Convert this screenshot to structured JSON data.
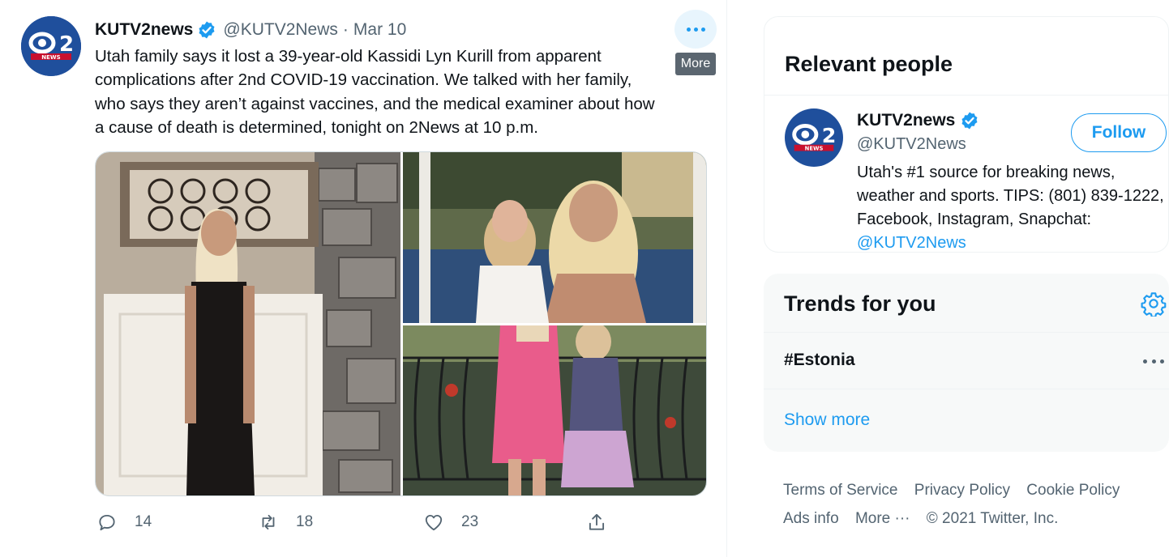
{
  "tweet": {
    "author": {
      "display_name": "KUTV2news",
      "handle": "@KUTV2News",
      "verified": true,
      "avatar_text": "2",
      "avatar_subtext": "NEWS"
    },
    "separator": "·",
    "date": "Mar 10",
    "more_tooltip": "More",
    "text": "Utah family says it lost a 39-year-old Kassidi Lyn Kurill  from apparent\ncomplications after 2nd COVID-19 vaccination. We talked with her family,\nwho says they aren’t against vaccines, and the medical examiner about how\na cause of death is determined, tonight on 2News at 10 p.m.",
    "media": [
      {
        "kind": "photo",
        "subject": "woman in black dress by stone wall"
      },
      {
        "kind": "photo",
        "subject": "woman and girl at restaurant patio"
      },
      {
        "kind": "photo",
        "subject": "woman in pink dress with girl by iron fence"
      }
    ],
    "actions": {
      "replies": "14",
      "retweets": "18",
      "likes": "23"
    }
  },
  "sidebar": {
    "relevant_people": {
      "title": "Relevant people",
      "person": {
        "display_name": "KUTV2news",
        "handle": "@KUTV2News",
        "bio": "Utah's #1 source for breaking news, weather and sports. TIPS: (801) 839-1222, Facebook, Instagram, Snapchat: ",
        "bio_link": "@KUTV2News",
        "follow_label": "Follow"
      }
    },
    "trends": {
      "title": "Trends for you",
      "items": [
        {
          "name": "#Estonia"
        }
      ],
      "show_more": "Show more"
    },
    "footer": {
      "links": [
        "Terms of Service",
        "Privacy Policy",
        "Cookie Policy",
        "Ads info",
        "More ···",
        "© 2021 Twitter, Inc."
      ]
    }
  },
  "colors": {
    "accent": "#1d9bf0",
    "text_primary": "#0f1419",
    "text_secondary": "#536471",
    "card_bg": "#f7f9f9",
    "avatar_blue": "#1f4f9c"
  }
}
